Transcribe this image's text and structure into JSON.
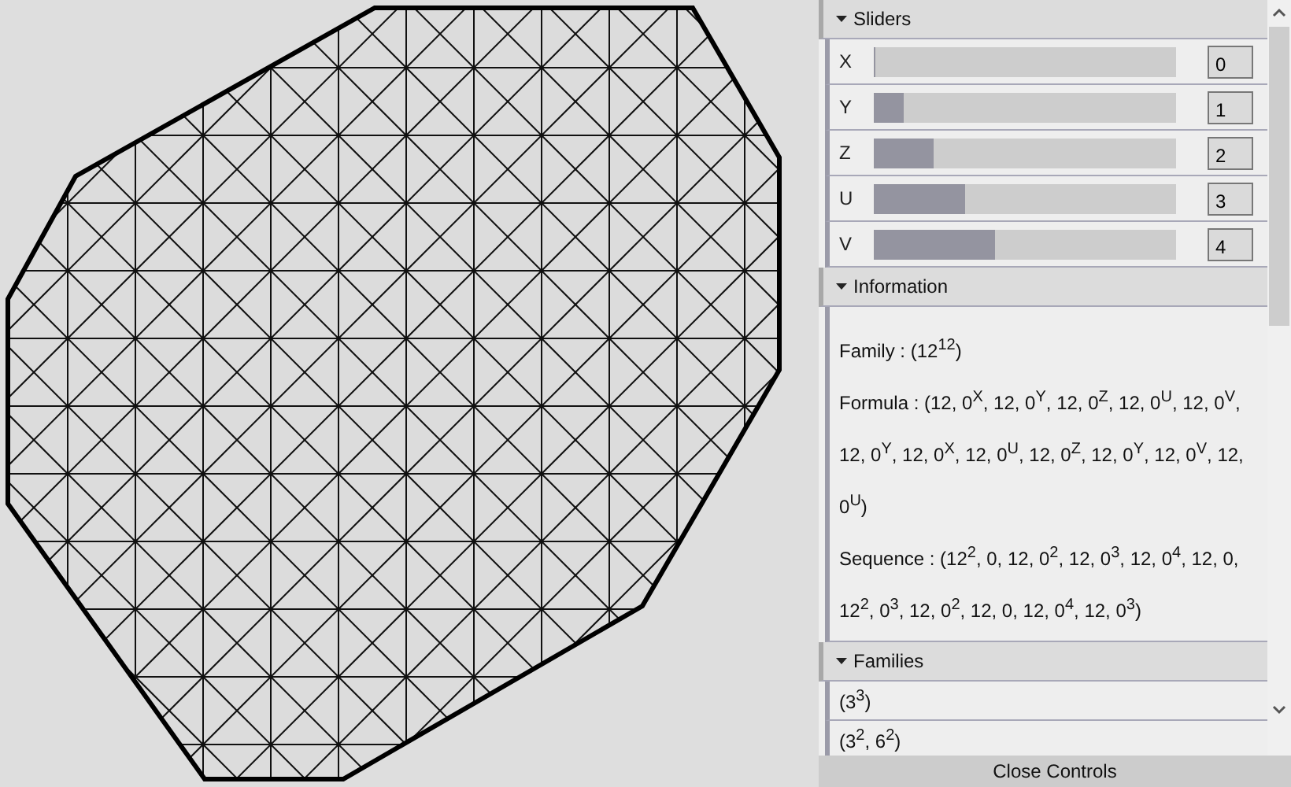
{
  "sections": [
    {
      "kind": "sliders",
      "title": "Sliders",
      "expanded": true,
      "sliders": [
        {
          "label": "X",
          "level": 0,
          "value": "0"
        },
        {
          "label": "Y",
          "level": 0.1,
          "value": "1"
        },
        {
          "label": "Z",
          "level": 0.2,
          "value": "2"
        },
        {
          "label": "U",
          "level": 0.3,
          "value": "3"
        },
        {
          "label": "V",
          "level": 0.4,
          "value": "4"
        }
      ]
    },
    {
      "kind": "info",
      "title": "Information",
      "expanded": true,
      "lines": [
        "Family : (12$^{12}$)",
        "Formula : (12, 0$^{X}$, 12, 0$^{Y}$, 12, 0$^{Z}$, 12, 0$^{U}$, 12, 0$^{V}$, 12, 0$^{Y}$, 12, 0$^{X}$, 12, 0$^{U}$, 12, 0$^{Z}$, 12, 0$^{Y}$, 12, 0$^{V}$, 12, 0$^{U}$)",
        "Sequence : (12$^{2}$, 0, 12, 0$^{2}$, 12, 0$^{3}$, 12, 0$^{4}$, 12, 0, 12$^{2}$, 0$^{3}$, 12, 0$^{2}$, 12, 0, 12, 0$^{4}$, 12, 0$^{3}$)"
      ]
    },
    {
      "kind": "list",
      "title": "Families",
      "expanded": true,
      "items": [
        "(3$^{3}$)",
        "(3$^{2}$, 6$^{2}$)"
      ]
    }
  ],
  "close_button": "Close Controls"
}
